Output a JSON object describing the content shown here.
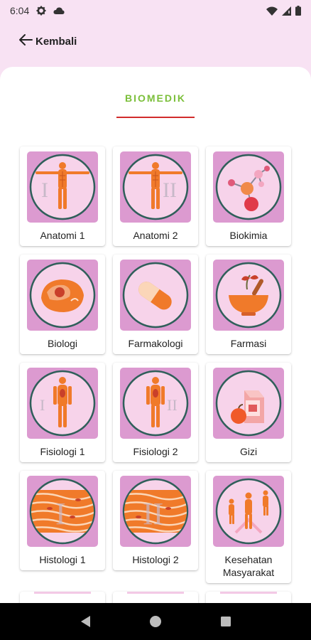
{
  "status_bar": {
    "time": "6:04",
    "icons_left": [
      "gear-icon",
      "cloud-icon"
    ],
    "icons_right": [
      "wifi-icon",
      "signal-icon",
      "battery-icon"
    ]
  },
  "app_bar": {
    "back_label": "Kembali"
  },
  "tab": {
    "label": "BIOMEDIK",
    "label_color": "#7bbf3a",
    "indicator_color": "#d22c2c"
  },
  "colors": {
    "background": "#f8e2f3",
    "tile": "#dc9ad0",
    "circle_fill": "#f7d3ea",
    "circle_stroke": "#2f5f5a",
    "accent_orange": "#f07a2a"
  },
  "subjects": [
    {
      "label": "Anatomi 1",
      "icon": "anatomy-body-icon"
    },
    {
      "label": "Anatomi 2",
      "icon": "anatomy-body-icon"
    },
    {
      "label": "Biokimia",
      "icon": "molecule-icon"
    },
    {
      "label": "Biologi",
      "icon": "cell-icon"
    },
    {
      "label": "Farmakologi",
      "icon": "capsule-icon"
    },
    {
      "label": "Farmasi",
      "icon": "mortar-pestle-icon"
    },
    {
      "label": "Fisiologi 1",
      "icon": "physiology-body-icon"
    },
    {
      "label": "Fisiologi 2",
      "icon": "physiology-body-icon"
    },
    {
      "label": "Gizi",
      "icon": "milk-apple-icon"
    },
    {
      "label": "Histologi 1",
      "icon": "tissue-fibers-icon"
    },
    {
      "label": "Histologi 2",
      "icon": "tissue-fibers-icon"
    },
    {
      "label": "Kesehatan Masyarakat",
      "icon": "people-group-icon"
    }
  ],
  "nav": {
    "buttons": [
      "back-nav-icon",
      "home-nav-icon",
      "recents-nav-icon"
    ]
  }
}
